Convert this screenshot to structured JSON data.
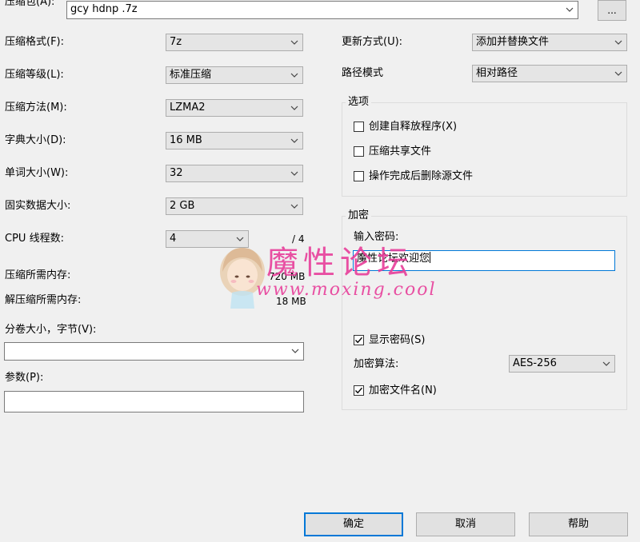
{
  "archive": {
    "label": "压缩包(A):",
    "value": "gcy hdnp .7z",
    "browse_label": "..."
  },
  "left": {
    "format": {
      "label": "压缩格式(F):",
      "value": "7z"
    },
    "level": {
      "label": "压缩等级(L):",
      "value": "标准压缩"
    },
    "method": {
      "label": "压缩方法(M):",
      "value": "LZMA2"
    },
    "dictionary": {
      "label": "字典大小(D):",
      "value": "16 MB"
    },
    "word": {
      "label": "单词大小(W):",
      "value": "32"
    },
    "solid": {
      "label": "固实数据大小:",
      "value": "2 GB"
    },
    "threads": {
      "label": "CPU 线程数:",
      "value": "4",
      "total": "/ 4"
    },
    "mem_compress": {
      "label": "压缩所需内存:",
      "value": "720 MB"
    },
    "mem_decompress": {
      "label": "解压缩所需内存:",
      "value": "18 MB"
    },
    "volume": {
      "label": "分卷大小，字节(V):",
      "value": ""
    },
    "params": {
      "label": "参数(P):",
      "value": ""
    }
  },
  "right": {
    "update_mode": {
      "label": "更新方式(U):",
      "value": "添加并替换文件"
    },
    "path_mode": {
      "label": "路径模式",
      "value": "相对路径"
    },
    "options": {
      "title": "选项",
      "items": [
        {
          "label": "创建自释放程序(X)",
          "checked": false
        },
        {
          "label": "压缩共享文件",
          "checked": false
        },
        {
          "label": "操作完成后删除源文件",
          "checked": false
        }
      ]
    },
    "encryption": {
      "title": "加密",
      "password_label": "输入密码:",
      "password_value": "魔性论坛欢迎您",
      "show_password": {
        "label": "显示密码(S)",
        "checked": true
      },
      "method_label": "加密算法:",
      "method_value": "AES-256",
      "encrypt_names": {
        "label": "加密文件名(N)",
        "checked": true
      }
    }
  },
  "buttons": {
    "ok": "确定",
    "cancel": "取消",
    "help": "帮助"
  },
  "watermark": {
    "title": "魔性论坛",
    "url": "www.moxing.cool"
  },
  "colors": {
    "accent": "#0078d7",
    "watermark": "#e83e9a"
  }
}
